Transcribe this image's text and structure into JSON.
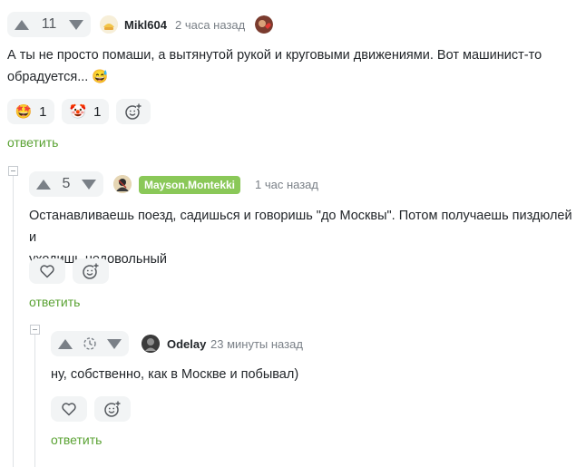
{
  "comments": [
    {
      "votes": "11",
      "username": "Mikl604",
      "time": "2 часа назад",
      "text_line1": "А ты не просто помаши, а вытянутой рукой и круговыми движениями. Вот машинист-то",
      "text_line2": "обрадуется... 😅",
      "reactions": [
        {
          "emoji": "🤩",
          "count": "1"
        },
        {
          "emoji": "🤡",
          "count": "1"
        }
      ],
      "add_reaction_icon": "emoji-plus-icon",
      "reply_label": "ответить"
    },
    {
      "votes": "5",
      "username": "Mayson.Montekki",
      "time": "1 час назад",
      "text_line1": "Останавливаешь поезд, садишься и говоришь \"до Москвы\". Потом получаешь пиздюлей и",
      "text_line2": "уходишь недовольный",
      "like_icon": "heart-icon",
      "add_reaction_icon": "emoji-plus-icon",
      "reply_label": "ответить"
    },
    {
      "votes_icon": "clock-icon",
      "username": "Odelay",
      "time": "23 минуты назад",
      "text_line1": "ну, собственно, как в Москве и побывал)",
      "like_icon": "heart-icon",
      "add_reaction_icon": "emoji-plus-icon",
      "reply_label": "ответить"
    }
  ],
  "colors": {
    "accent_green": "#5aa233",
    "badge_green": "#8ac858",
    "pill_bg": "#f2f4f5",
    "muted_text": "#7a8087"
  }
}
